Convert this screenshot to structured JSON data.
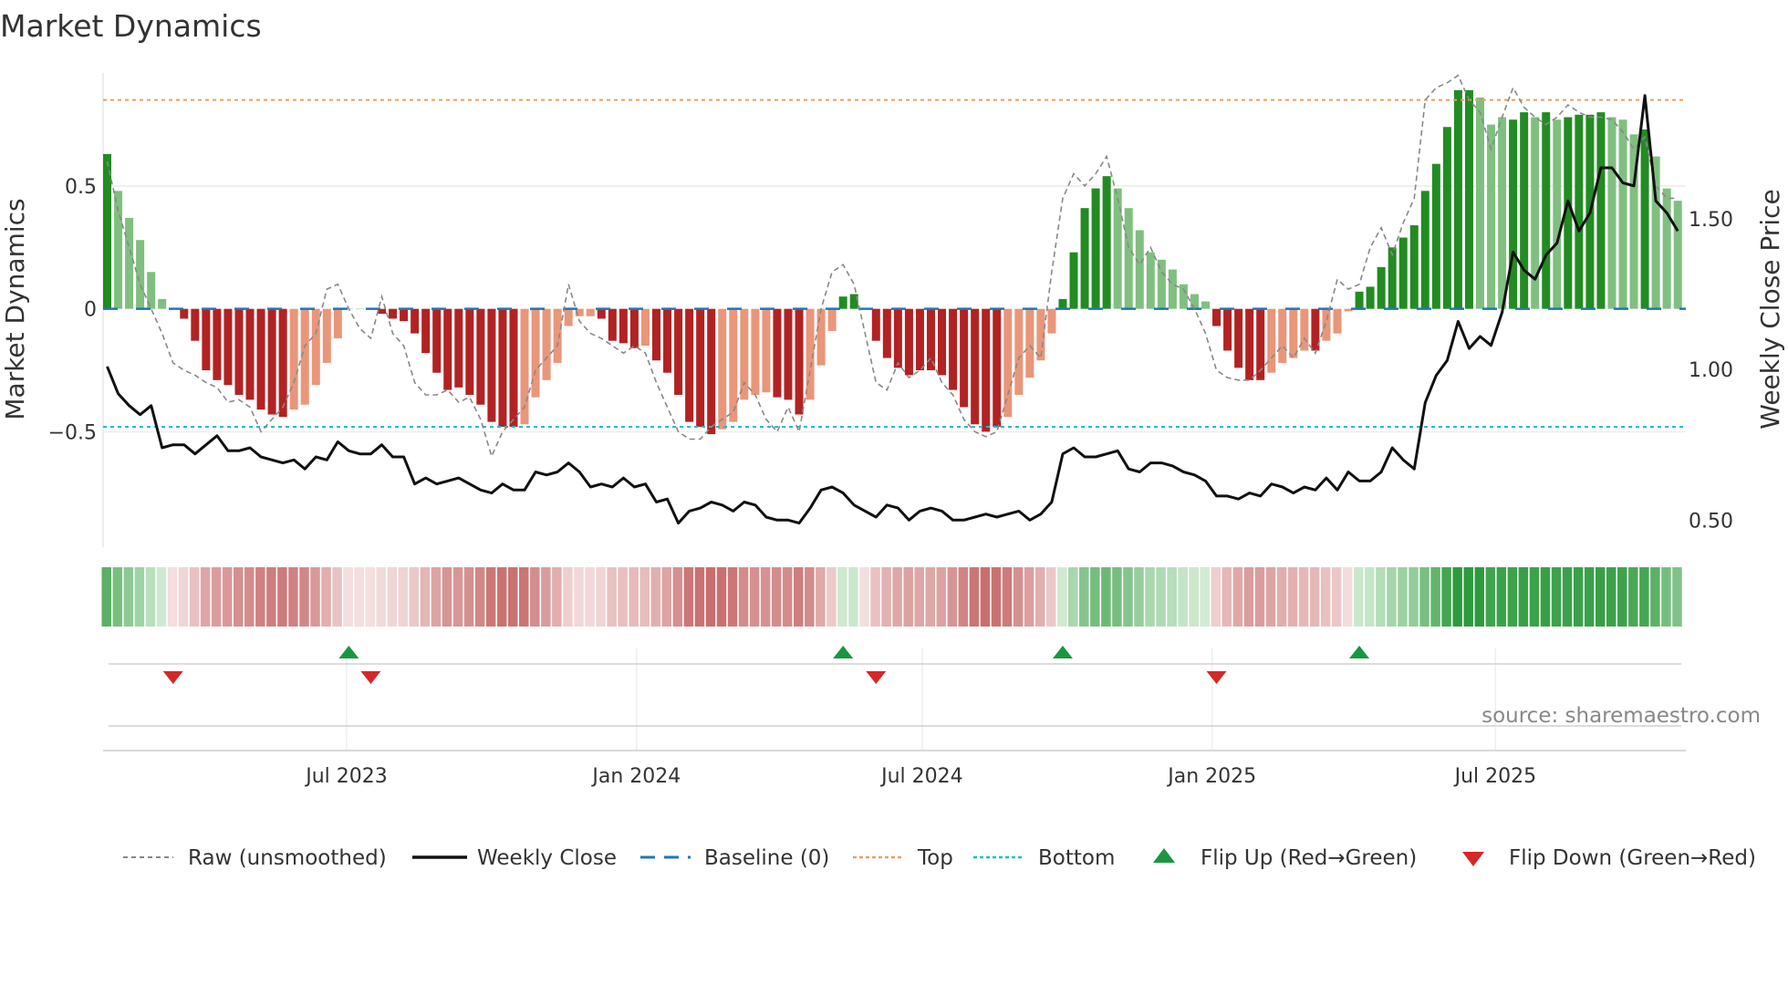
{
  "chart_data": {
    "type": "bar",
    "title": "Market Dynamics",
    "ylabel": "Market Dynamics",
    "y2label": "Weekly Close Price",
    "ylim": [
      -0.97,
      0.96
    ],
    "y2lim": [
      0.41,
      1.985
    ],
    "yticks": [
      {
        "v": 0.5,
        "label": "0.5"
      },
      {
        "v": 0,
        "label": "0"
      },
      {
        "v": -0.5,
        "label": "−0.5"
      }
    ],
    "y2ticks": [
      {
        "v": 1.5,
        "label": "1.50"
      },
      {
        "v": 1.0,
        "label": "1.00"
      },
      {
        "v": 0.5,
        "label": "0.50"
      }
    ],
    "xticks": [
      {
        "week": 22.8,
        "label": "Jul 2023"
      },
      {
        "week": 49.2,
        "label": "Jan 2024"
      },
      {
        "week": 75.2,
        "label": "Jul 2024"
      },
      {
        "week": 101.6,
        "label": "Jan 2025"
      },
      {
        "week": 127.4,
        "label": "Jul 2025"
      }
    ],
    "top_level": 0.85,
    "bottom_level": -0.48,
    "baseline": 0,
    "values": [
      0.63,
      0.48,
      0.37,
      0.28,
      0.15,
      0.04,
      0.0,
      -0.04,
      -0.13,
      -0.25,
      -0.29,
      -0.31,
      -0.35,
      -0.37,
      -0.41,
      -0.43,
      -0.44,
      -0.41,
      -0.39,
      -0.31,
      -0.22,
      -0.12,
      0.0,
      0.0,
      0.0,
      -0.02,
      -0.04,
      -0.05,
      -0.1,
      -0.18,
      -0.26,
      -0.33,
      -0.32,
      -0.35,
      -0.39,
      -0.46,
      -0.48,
      -0.48,
      -0.47,
      -0.36,
      -0.29,
      -0.22,
      -0.07,
      -0.03,
      -0.03,
      -0.04,
      -0.13,
      -0.14,
      -0.16,
      -0.15,
      -0.21,
      -0.26,
      -0.35,
      -0.46,
      -0.48,
      -0.51,
      -0.49,
      -0.46,
      -0.37,
      -0.35,
      -0.34,
      -0.36,
      -0.37,
      -0.43,
      -0.37,
      -0.23,
      -0.09,
      0.05,
      0.06,
      0.0,
      -0.13,
      -0.2,
      -0.24,
      -0.27,
      -0.25,
      -0.25,
      -0.27,
      -0.33,
      -0.4,
      -0.47,
      -0.5,
      -0.48,
      -0.44,
      -0.35,
      -0.28,
      -0.21,
      -0.1,
      0.04,
      0.23,
      0.41,
      0.49,
      0.54,
      0.49,
      0.41,
      0.32,
      0.23,
      0.2,
      0.16,
      0.1,
      0.06,
      0.03,
      -0.07,
      -0.17,
      -0.24,
      -0.29,
      -0.29,
      -0.26,
      -0.22,
      -0.2,
      -0.17,
      -0.17,
      -0.13,
      -0.1,
      -0.01,
      0.07,
      0.09,
      0.17,
      0.25,
      0.29,
      0.34,
      0.48,
      0.59,
      0.74,
      0.89,
      0.89,
      0.86,
      0.75,
      0.78,
      0.77,
      0.8,
      0.78,
      0.8,
      0.77,
      0.78,
      0.79,
      0.79,
      0.8,
      0.78,
      0.77,
      0.71,
      0.73,
      0.62,
      0.49,
      0.44
    ],
    "strength": [
      1,
      0,
      0,
      0,
      0,
      0,
      0,
      1,
      1,
      1,
      1,
      1,
      1,
      1,
      1,
      1,
      1,
      0,
      0,
      0,
      0,
      0,
      0,
      0,
      0,
      1,
      1,
      1,
      1,
      1,
      1,
      1,
      1,
      1,
      1,
      1,
      1,
      1,
      0,
      0,
      0,
      0,
      0,
      0,
      0,
      1,
      1,
      1,
      1,
      0,
      1,
      1,
      1,
      1,
      1,
      1,
      0,
      0,
      0,
      0,
      0,
      1,
      1,
      1,
      0,
      0,
      0,
      1,
      1,
      0,
      1,
      1,
      1,
      1,
      1,
      1,
      1,
      1,
      1,
      1,
      1,
      1,
      0,
      0,
      0,
      0,
      0,
      1,
      1,
      1,
      1,
      1,
      0,
      0,
      0,
      0,
      0,
      0,
      0,
      0,
      0,
      1,
      1,
      1,
      1,
      1,
      0,
      0,
      0,
      0,
      1,
      0,
      0,
      0,
      1,
      1,
      1,
      1,
      1,
      1,
      1,
      1,
      1,
      1,
      1,
      0,
      0,
      0,
      1,
      1,
      0,
      1,
      0,
      1,
      1,
      1,
      1,
      0,
      0,
      0,
      1,
      0,
      0,
      0
    ],
    "raw": [
      0.6,
      0.4,
      0.25,
      0.1,
      0.0,
      -0.1,
      -0.22,
      -0.25,
      -0.27,
      -0.3,
      -0.32,
      -0.38,
      -0.37,
      -0.4,
      -0.5,
      -0.45,
      -0.4,
      -0.3,
      -0.15,
      -0.1,
      0.08,
      0.1,
      0.0,
      -0.08,
      -0.12,
      0.05,
      -0.1,
      -0.15,
      -0.3,
      -0.35,
      -0.35,
      -0.33,
      -0.38,
      -0.36,
      -0.45,
      -0.6,
      -0.5,
      -0.45,
      -0.4,
      -0.25,
      -0.2,
      -0.15,
      0.1,
      -0.05,
      -0.1,
      -0.12,
      -0.15,
      -0.18,
      -0.15,
      -0.18,
      -0.3,
      -0.4,
      -0.5,
      -0.53,
      -0.53,
      -0.48,
      -0.45,
      -0.42,
      -0.3,
      -0.35,
      -0.45,
      -0.5,
      -0.4,
      -0.5,
      -0.25,
      0.0,
      0.15,
      0.18,
      0.1,
      -0.1,
      -0.3,
      -0.33,
      -0.22,
      -0.28,
      -0.25,
      -0.2,
      -0.3,
      -0.35,
      -0.45,
      -0.5,
      -0.52,
      -0.5,
      -0.35,
      -0.2,
      -0.15,
      -0.2,
      0.15,
      0.45,
      0.55,
      0.5,
      0.55,
      0.62,
      0.45,
      0.25,
      0.18,
      0.25,
      0.15,
      0.1,
      0.08,
      0.0,
      -0.1,
      -0.25,
      -0.28,
      -0.29,
      -0.29,
      -0.25,
      -0.2,
      -0.15,
      -0.2,
      -0.12,
      -0.18,
      -0.05,
      0.12,
      0.08,
      0.1,
      0.25,
      0.33,
      0.22,
      0.35,
      0.45,
      0.85,
      0.9,
      0.92,
      0.95,
      0.85,
      0.8,
      0.65,
      0.78,
      0.9,
      0.82,
      0.78,
      0.75,
      0.78,
      0.83,
      0.8,
      0.78,
      0.78,
      0.77,
      0.72,
      0.65,
      0.7,
      0.5,
      0.45,
      0.45
    ],
    "close": [
      1.01,
      0.92,
      0.88,
      0.85,
      0.88,
      0.74,
      0.75,
      0.75,
      0.72,
      0.75,
      0.78,
      0.73,
      0.73,
      0.74,
      0.71,
      0.7,
      0.69,
      0.7,
      0.67,
      0.71,
      0.7,
      0.76,
      0.73,
      0.72,
      0.72,
      0.75,
      0.71,
      0.71,
      0.62,
      0.64,
      0.62,
      0.63,
      0.64,
      0.62,
      0.6,
      0.59,
      0.62,
      0.6,
      0.6,
      0.66,
      0.65,
      0.66,
      0.69,
      0.66,
      0.61,
      0.62,
      0.61,
      0.64,
      0.61,
      0.62,
      0.56,
      0.57,
      0.49,
      0.53,
      0.54,
      0.56,
      0.55,
      0.53,
      0.56,
      0.55,
      0.51,
      0.5,
      0.5,
      0.49,
      0.54,
      0.6,
      0.61,
      0.59,
      0.55,
      0.53,
      0.51,
      0.55,
      0.54,
      0.5,
      0.53,
      0.54,
      0.53,
      0.5,
      0.5,
      0.51,
      0.52,
      0.51,
      0.52,
      0.53,
      0.5,
      0.52,
      0.56,
      0.72,
      0.74,
      0.71,
      0.71,
      0.72,
      0.73,
      0.67,
      0.66,
      0.69,
      0.69,
      0.68,
      0.66,
      0.65,
      0.63,
      0.58,
      0.58,
      0.57,
      0.59,
      0.58,
      0.62,
      0.61,
      0.59,
      0.61,
      0.6,
      0.64,
      0.6,
      0.66,
      0.63,
      0.63,
      0.66,
      0.74,
      0.7,
      0.67,
      0.89,
      0.98,
      1.03,
      1.16,
      1.07,
      1.11,
      1.08,
      1.19,
      1.39,
      1.33,
      1.3,
      1.38,
      1.42,
      1.56,
      1.46,
      1.52,
      1.67,
      1.67,
      1.62,
      1.61,
      1.91,
      1.56,
      1.52,
      1.46
    ],
    "flip_up_weeks": [
      23,
      68,
      88,
      115
    ],
    "flip_down_weeks": [
      7,
      25,
      71,
      102
    ],
    "legend_position": "bottom",
    "colors": {
      "pos_strong": "#228b22",
      "pos_weak": "#80bf80",
      "neg_strong": "#b22222",
      "neg_weak": "#e9967a",
      "close": "#111111",
      "raw": "#888888",
      "baseline": "#1f77b4",
      "top": "#e8a060",
      "bottom": "#17becf",
      "flip_up": "#1a9641",
      "flip_down": "#d62728"
    }
  },
  "legend": {
    "raw": "Raw (unsmoothed)",
    "close": "Weekly Close",
    "baseline": "Baseline (0)",
    "top": "Top",
    "bottom": "Bottom",
    "flip_up": "Flip Up (Red→Green)",
    "flip_down": "Flip Down (Green→Red)"
  },
  "source": "source: sharemaestro.com"
}
